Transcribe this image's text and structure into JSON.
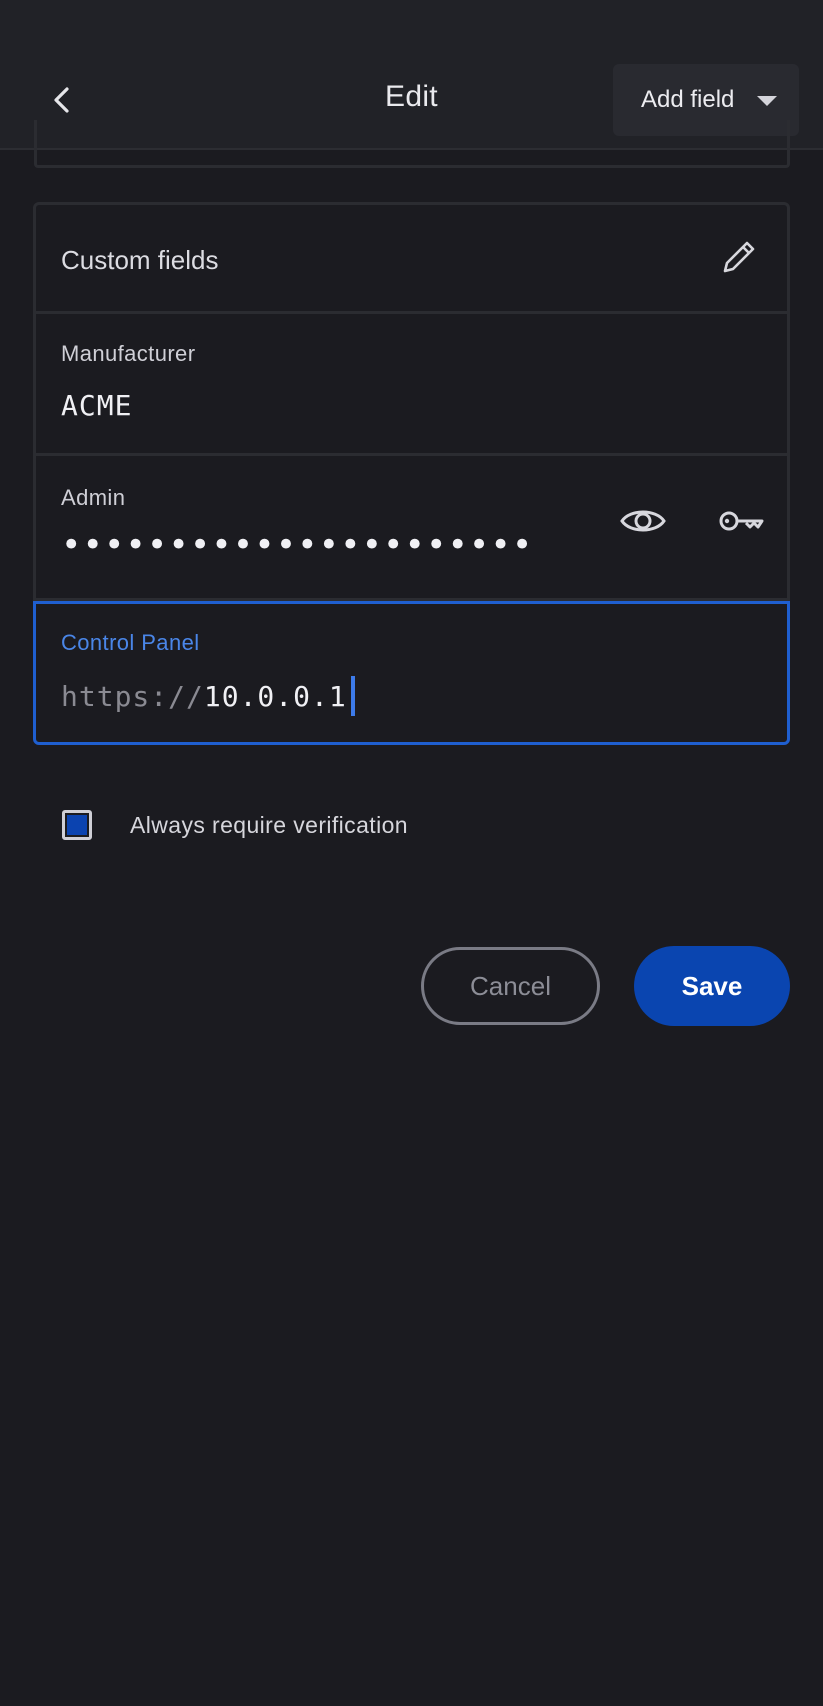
{
  "header": {
    "title": "Edit",
    "add_field_label": "Add field"
  },
  "custom_fields": {
    "section_label": "Custom fields"
  },
  "fields": [
    {
      "label": "Manufacturer",
      "value": "ACME",
      "type": "text"
    },
    {
      "label": "Admin",
      "value": "••••••••••••••••••••••",
      "type": "password"
    },
    {
      "label": "Control Panel",
      "prefix": "https://",
      "value": "10.0.0.1",
      "type": "url",
      "focused": true
    }
  ],
  "verification": {
    "label": "Always require verification",
    "checked": true
  },
  "actions": {
    "cancel_label": "Cancel",
    "save_label": "Save"
  },
  "colors": {
    "background": "#1b1b20",
    "accent": "#1f5fd0",
    "save_button": "#0a45b0"
  },
  "icons": {
    "back": "chevron-left-icon",
    "dropdown": "caret-down-icon",
    "edit": "pencil-icon",
    "reveal": "eye-icon",
    "generate": "key-icon"
  }
}
